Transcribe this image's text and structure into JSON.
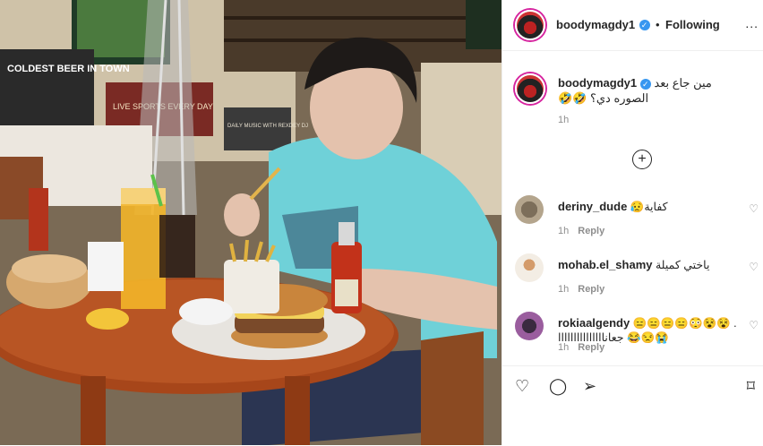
{
  "header": {
    "username": "boodymagdy1",
    "verified_icon": "verified-badge-icon",
    "separator": "•",
    "follow_status": "Following",
    "more": "..."
  },
  "caption": {
    "username": "boodymagdy1",
    "text": "مين جاع بعد الصوره دي؟ 🤣🤣",
    "time": "1h"
  },
  "load_more_icon": "plus-circle-icon",
  "comments": [
    {
      "username": "deriny_dude",
      "text": "كفاية😥",
      "time": "1h",
      "reply": "Reply"
    },
    {
      "username": "mohab.el_shamy",
      "text": "ياختي كميلة",
      "time": "1h",
      "reply": "Reply"
    },
    {
      "username": "rokiaalgendy",
      "text": ". 😵😵😳😑😑😑😑😭😒😂 جعانااااااااااااااا",
      "time": "1h",
      "reply": "Reply"
    }
  ],
  "photo": {
    "sign_1": "COLDEST BEER IN TOWN",
    "sign_2": "LIVE SPORTS EVERY DAY",
    "sign_3": "DAILY MUSIC WITH REXDEY DJ"
  },
  "colors": {
    "accent": "#3897f0",
    "text": "#262626",
    "muted": "#8e8e8e",
    "story_ring": "#d6249f"
  }
}
